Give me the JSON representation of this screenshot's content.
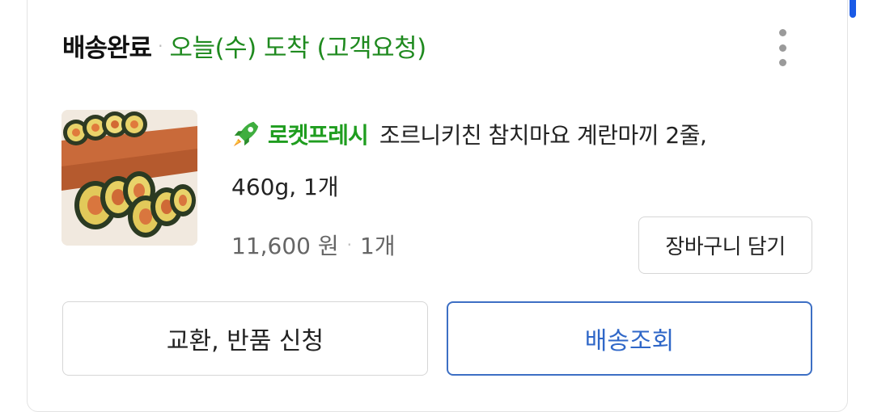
{
  "order": {
    "status": "배송완료",
    "separator": "·",
    "arrival": "오늘(수) 도착 (고객요청)",
    "more_icon": "more-vertical-icon"
  },
  "product": {
    "rocket_badge": "로켓프레시",
    "rocket_icon": "rocket-icon",
    "name_line1": "조르니키친 참치마요 계란마끼 2줄,",
    "name_line2": "460g, 1개",
    "price": "11,600 원",
    "separator": "·",
    "quantity": "1개"
  },
  "actions": {
    "add_to_cart": "장바구니 담기",
    "return_exchange": "교환, 반품 신청",
    "track_delivery": "배송조회"
  },
  "colors": {
    "accent_green": "#1f8a1f",
    "rocket_green": "#1f9d1f",
    "link_blue": "#2f67c8",
    "corner_blue": "#1a5ae6"
  }
}
